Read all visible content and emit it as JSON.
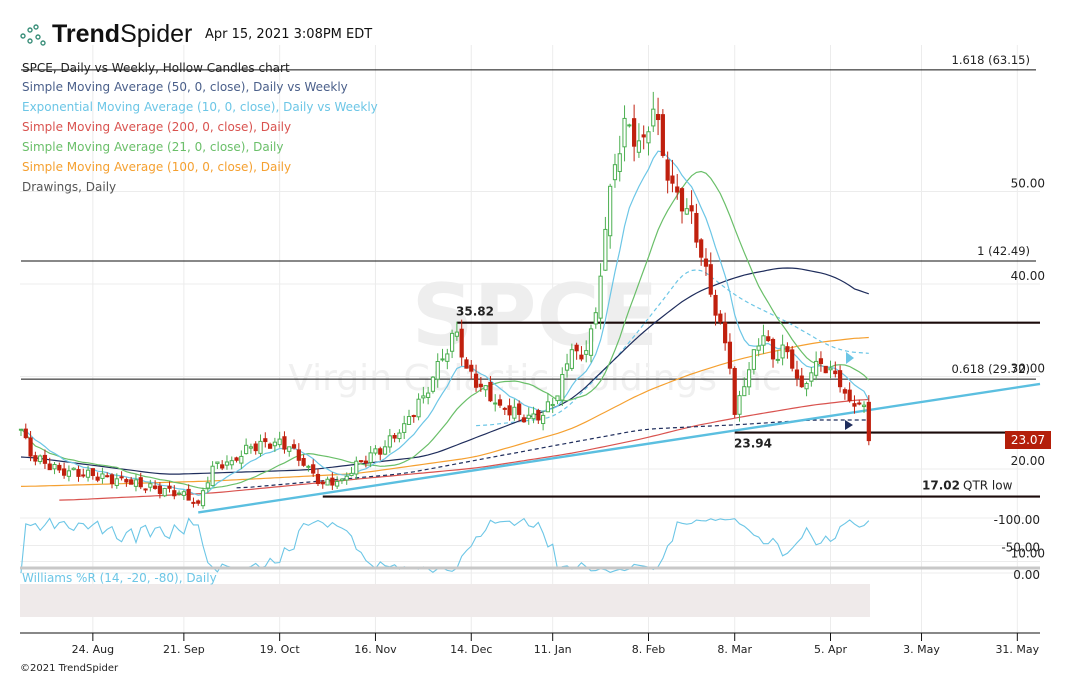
{
  "header": {
    "logo_text_bold": "Trend",
    "logo_text_light": "Spider",
    "timestamp": "Apr 15, 2021 3:08PM EDT",
    "copyright": "©2021 TrendSpider"
  },
  "legend": [
    {
      "label": "SPCE, Daily vs Weekly, Hollow Candles chart",
      "color": "#222222"
    },
    {
      "label": "Simple Moving Average (50, 0, close), Daily vs Weekly",
      "color": "#4a5f8a"
    },
    {
      "label": "Exponential Moving Average (10, 0, close), Daily vs Weekly",
      "color": "#6cc6e6"
    },
    {
      "label": "Simple Moving Average (200, 0, close), Daily",
      "color": "#d9534f"
    },
    {
      "label": "Simple Moving Average (21, 0, close), Daily",
      "color": "#6abf69"
    },
    {
      "label": "Simple Moving Average (100, 0, close), Daily",
      "color": "#f5a030"
    },
    {
      "label": "Drawings, Daily",
      "color": "#555555"
    }
  ],
  "watermark": {
    "symbol": "SPCE",
    "name": "Virgin Galactic Holdings Inc"
  },
  "chart_data": {
    "type": "candlestick",
    "symbol": "SPCE",
    "x_unit": "trading day index",
    "ylim": [
      10,
      63.15
    ],
    "y_ticks": [
      "10.00",
      "20.00",
      "30.00",
      "40.00",
      "50.00"
    ],
    "y_tick_values": [
      10,
      20,
      30,
      40,
      50
    ],
    "x_ticks": [
      {
        "label": "24. Aug",
        "day": 15
      },
      {
        "label": "21. Sep",
        "day": 34
      },
      {
        "label": "19. Oct",
        "day": 54
      },
      {
        "label": "16. Nov",
        "day": 74
      },
      {
        "label": "14. Dec",
        "day": 94
      },
      {
        "label": "11. Jan",
        "day": 111
      },
      {
        "label": "8. Feb",
        "day": 131
      },
      {
        "label": "8. Mar",
        "day": 149
      },
      {
        "label": "5. Apr",
        "day": 169
      },
      {
        "label": "3. May",
        "day": 188
      },
      {
        "label": "31. May",
        "day": 208
      }
    ],
    "close_keypoints": [
      [
        0,
        24.3
      ],
      [
        2,
        21.4
      ],
      [
        8,
        19.9
      ],
      [
        15,
        19.3
      ],
      [
        22,
        18.6
      ],
      [
        28,
        17.9
      ],
      [
        33,
        17.4
      ],
      [
        37,
        16.3
      ],
      [
        40,
        20.3
      ],
      [
        44,
        20.9
      ],
      [
        48,
        22.4
      ],
      [
        53,
        22.9
      ],
      [
        56,
        22.4
      ],
      [
        59,
        20.4
      ],
      [
        63,
        18.4
      ],
      [
        67,
        18.9
      ],
      [
        71,
        20.9
      ],
      [
        76,
        22.4
      ],
      [
        80,
        24.9
      ],
      [
        84,
        27.9
      ],
      [
        88,
        31.9
      ],
      [
        91,
        34.8
      ],
      [
        93,
        30.9
      ],
      [
        96,
        28.9
      ],
      [
        100,
        26.9
      ],
      [
        104,
        25.9
      ],
      [
        108,
        25.3
      ],
      [
        112,
        27.9
      ],
      [
        115,
        32.9
      ],
      [
        117,
        31.9
      ],
      [
        120,
        36.9
      ],
      [
        122,
        45.9
      ],
      [
        124,
        52.9
      ],
      [
        126,
        57.9
      ],
      [
        128,
        54.9
      ],
      [
        130,
        55.9
      ],
      [
        132,
        58.9
      ],
      [
        134,
        53.9
      ],
      [
        136,
        50.9
      ],
      [
        138,
        47.9
      ],
      [
        140,
        47.9
      ],
      [
        142,
        42.9
      ],
      [
        144,
        38.9
      ],
      [
        146,
        35.9
      ],
      [
        148,
        30.9
      ],
      [
        149,
        25.9
      ],
      [
        151,
        28.9
      ],
      [
        153,
        32.9
      ],
      [
        155,
        34.4
      ],
      [
        157,
        31.9
      ],
      [
        159,
        33.4
      ],
      [
        161,
        30.9
      ],
      [
        163,
        28.9
      ],
      [
        165,
        30.4
      ],
      [
        167,
        31.4
      ],
      [
        169,
        30.9
      ],
      [
        171,
        28.9
      ],
      [
        173,
        27.4
      ],
      [
        175,
        27.1
      ],
      [
        176,
        26.9
      ],
      [
        177,
        23.07
      ]
    ],
    "last_price": "23.07",
    "series": [
      {
        "name": "SMA 200 Daily",
        "color": "#d9534f",
        "dashed": false,
        "points": [
          [
            8,
            16.6
          ],
          [
            40,
            17.4
          ],
          [
            70,
            18.9
          ],
          [
            95,
            20.1
          ],
          [
            115,
            21.7
          ],
          [
            130,
            23.3
          ],
          [
            140,
            24.6
          ],
          [
            150,
            25.6
          ],
          [
            165,
            26.9
          ],
          [
            177,
            27.6
          ]
        ]
      },
      {
        "name": "SMA 100 Daily",
        "color": "#f5a030",
        "dashed": false,
        "points": [
          [
            0,
            18.1
          ],
          [
            40,
            18.7
          ],
          [
            70,
            19.5
          ],
          [
            95,
            21.3
          ],
          [
            115,
            24.3
          ],
          [
            130,
            28.3
          ],
          [
            140,
            30.3
          ],
          [
            150,
            31.9
          ],
          [
            165,
            33.6
          ],
          [
            177,
            34.3
          ]
        ]
      },
      {
        "name": "SMA 50 Weekly",
        "color": "#1f2d5c",
        "dashed": true,
        "points": [
          [
            45,
            17.9
          ],
          [
            80,
            19.5
          ],
          [
            110,
            22.4
          ],
          [
            130,
            24.3
          ],
          [
            150,
            24.8
          ],
          [
            165,
            25.3
          ],
          [
            177,
            25.3
          ]
        ]
      },
      {
        "name": "EMA 10 Weekly",
        "color": "#6cc6e6",
        "dashed": true,
        "points": [
          [
            95,
            24.6
          ],
          [
            112,
            25.6
          ],
          [
            125,
            32.4
          ],
          [
            135,
            38.9
          ],
          [
            140,
            42.4
          ],
          [
            150,
            38.4
          ],
          [
            160,
            35.9
          ],
          [
            170,
            32.9
          ],
          [
            177,
            32.4
          ]
        ]
      },
      {
        "name": "SMA 50 Daily",
        "color": "#1f2d5c",
        "dashed": false,
        "points": [
          [
            0,
            21.4
          ],
          [
            30,
            19.4
          ],
          [
            60,
            19.9
          ],
          [
            85,
            21.4
          ],
          [
            100,
            24.4
          ],
          [
            115,
            27.4
          ],
          [
            130,
            34.9
          ],
          [
            140,
            38.9
          ],
          [
            150,
            40.9
          ],
          [
            160,
            41.9
          ],
          [
            170,
            40.9
          ],
          [
            177,
            38.4
          ]
        ]
      }
    ],
    "levels": [
      {
        "label": "1.618 (63.15)",
        "value": 63.15,
        "from_day": 0,
        "thick": false
      },
      {
        "label": "1 (42.49)",
        "value": 42.49,
        "from_day": 0,
        "thick": false
      },
      {
        "label": "0.618 (29.72)",
        "value": 29.72,
        "from_day": 0,
        "thick": false
      },
      {
        "label": "35.82",
        "value": 35.82,
        "from_day": 91,
        "thick": true
      },
      {
        "label": "23.94",
        "value": 23.94,
        "from_day": 149,
        "thick": true
      },
      {
        "label": "17.02",
        "suffix": "QTR low",
        "value": 17.02,
        "from_day": 63,
        "thick": true
      }
    ],
    "trendline": {
      "from": [
        37,
        15.3
      ],
      "to": [
        214,
        29.3
      ],
      "color": "#5bbfe0"
    },
    "williams": {
      "label": "Williams %R (14, -20, -80), Daily",
      "period": 14,
      "upper": -20,
      "lower": -80,
      "ylim": [
        -100,
        0
      ],
      "y_ticks": [
        "0.00",
        "-50.00",
        "-100.00"
      ],
      "y_tick_values": [
        0,
        -50,
        -100
      ],
      "color": "#6cc6e6"
    }
  }
}
